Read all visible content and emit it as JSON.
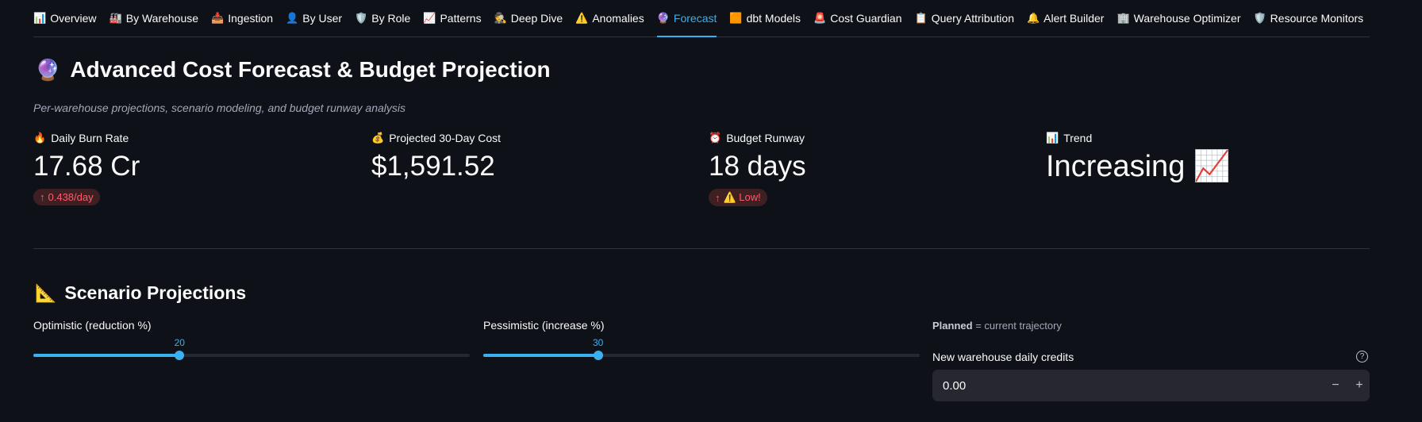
{
  "tabs": [
    {
      "icon": "📊",
      "label": "Overview",
      "name": "tab-overview"
    },
    {
      "icon": "🏭",
      "label": "By Warehouse",
      "name": "tab-by-warehouse"
    },
    {
      "icon": "📥",
      "label": "Ingestion",
      "name": "tab-ingestion"
    },
    {
      "icon": "👤",
      "label": "By User",
      "name": "tab-by-user"
    },
    {
      "icon": "🛡️",
      "label": "By Role",
      "name": "tab-by-role"
    },
    {
      "icon": "📈",
      "label": "Patterns",
      "name": "tab-patterns"
    },
    {
      "icon": "🕵️",
      "label": "Deep Dive",
      "name": "tab-deep-dive"
    },
    {
      "icon": "⚠️",
      "label": "Anomalies",
      "name": "tab-anomalies"
    },
    {
      "icon": "🔮",
      "label": "Forecast",
      "name": "tab-forecast",
      "active": true
    },
    {
      "icon": "🟧",
      "label": "dbt Models",
      "name": "tab-dbt-models"
    },
    {
      "icon": "🚨",
      "label": "Cost Guardian",
      "name": "tab-cost-guardian"
    },
    {
      "icon": "📋",
      "label": "Query Attribution",
      "name": "tab-query-attribution"
    },
    {
      "icon": "🔔",
      "label": "Alert Builder",
      "name": "tab-alert-builder"
    },
    {
      "icon": "🏢",
      "label": "Warehouse Optimizer",
      "name": "tab-warehouse-optimizer"
    },
    {
      "icon": "🛡️",
      "label": "Resource Monitors",
      "name": "tab-resource-monitors"
    }
  ],
  "header": {
    "icon": "🔮",
    "title": "Advanced Cost Forecast & Budget Projection",
    "subtitle": "Per-warehouse projections, scenario modeling, and budget runway analysis"
  },
  "metrics": {
    "burn": {
      "icon": "🔥",
      "label": "Daily Burn Rate",
      "value": "17.68 Cr",
      "delta": "0.438/day"
    },
    "projected": {
      "icon": "💰",
      "label": "Projected 30-Day Cost",
      "value": "$1,591.52"
    },
    "runway": {
      "icon": "⏰",
      "label": "Budget Runway",
      "value": "18 days",
      "delta": "⚠️ Low!"
    },
    "trend": {
      "icon": "📊",
      "label": "Trend",
      "value": "Increasing 📈"
    }
  },
  "scenario": {
    "icon": "📐",
    "title": "Scenario Projections",
    "optimistic": {
      "label": "Optimistic (reduction %)",
      "value": 20,
      "fraction": 0.2
    },
    "pessimistic": {
      "label": "Pessimistic (increase %)",
      "value": 30,
      "fraction": 0.3
    },
    "planned_bold": "Planned",
    "planned_rest": " = current trajectory",
    "new_wh_label": "New warehouse daily credits",
    "new_wh_value": "0.00",
    "help_glyph": "?",
    "minus": "−",
    "plus": "+"
  },
  "colors": {
    "accent": "#3ab0f0",
    "delta_red": "#ff5c6c"
  }
}
